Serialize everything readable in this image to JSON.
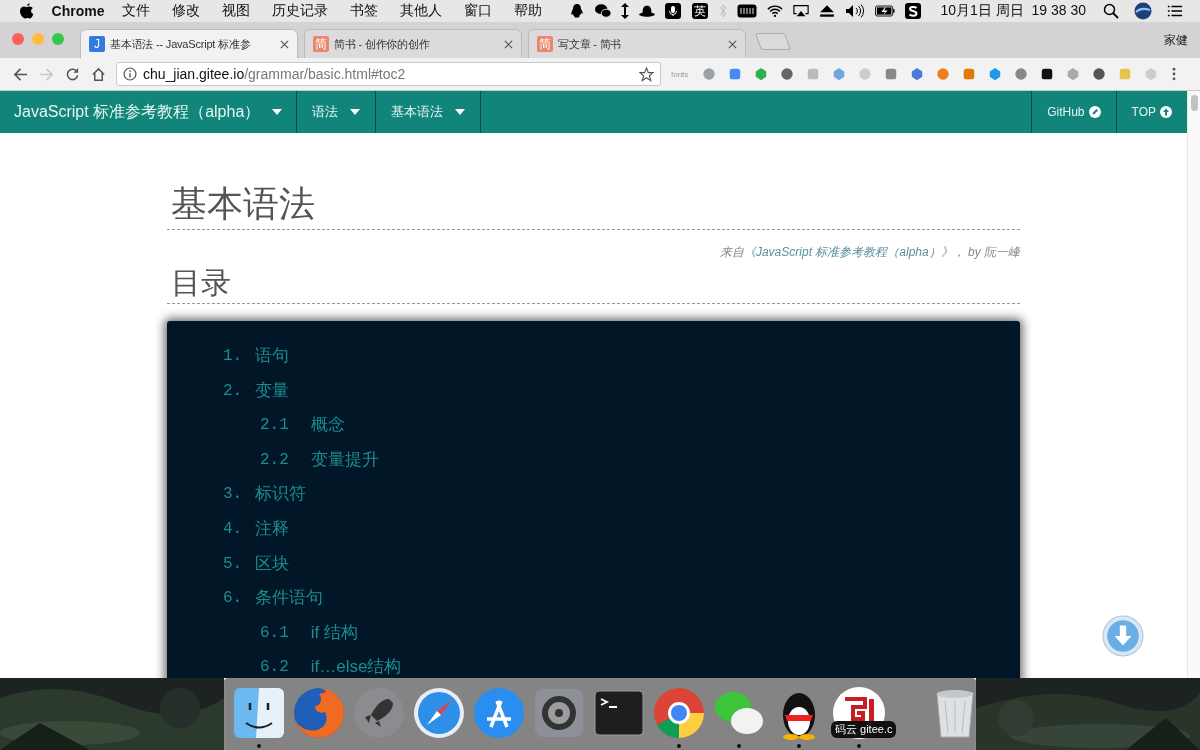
{
  "menu_bar": {
    "app": "Chrome",
    "menus": [
      "文件",
      "修改",
      "视图",
      "历史记录",
      "书签",
      "其他人",
      "窗口",
      "帮助"
    ],
    "input_method": "英",
    "clock": "10月1日 周日  19 38 30"
  },
  "browser": {
    "tabs": [
      {
        "title": "基本语法 -- JavaScript 标准参",
        "favicon": "J",
        "color": "#2f7be0",
        "selected": true
      },
      {
        "title": "简书 - 创作你的创作",
        "favicon": "简",
        "color": "#e9896b",
        "selected": false
      },
      {
        "title": "写文章 - 简书",
        "favicon": "简",
        "color": "#e9896b",
        "selected": false
      }
    ],
    "profile": "家健",
    "address": {
      "host": "chu_jian.gitee.io",
      "path": "/grammar/basic.html#toc2"
    },
    "extension_label": "fonts"
  },
  "page": {
    "navbar": {
      "brand": "JavaScript 标准参考教程（alpha）",
      "menus": [
        "语法",
        "基本语法"
      ],
      "links": [
        "GitHub",
        "TOP"
      ]
    },
    "title": "基本语法",
    "byline": {
      "prefix": "来自",
      "link": "《JavaScript 标准参考教程（alpha）》",
      "suffix": "， by 阮一峰"
    },
    "toc_title": "目录",
    "toc": [
      {
        "number": "1.",
        "label": "语句"
      },
      {
        "number": "2.",
        "label": "变量",
        "children": [
          {
            "number": "2.1",
            "label": "概念"
          },
          {
            "number": "2.2",
            "label": "变量提升"
          }
        ]
      },
      {
        "number": "3.",
        "label": "标识符"
      },
      {
        "number": "4.",
        "label": "注释"
      },
      {
        "number": "5.",
        "label": "区块"
      },
      {
        "number": "6.",
        "label": "条件语句",
        "children": [
          {
            "number": "6.1",
            "label": "if 结构"
          },
          {
            "number": "6.2",
            "label": "if…else结构"
          }
        ]
      }
    ]
  },
  "dock": {
    "apps": [
      {
        "kind": "finder",
        "running": true
      },
      {
        "kind": "firefox",
        "running": false
      },
      {
        "kind": "launchpad",
        "running": false
      },
      {
        "kind": "safari",
        "running": false
      },
      {
        "kind": "appstore",
        "running": false
      },
      {
        "kind": "settings",
        "running": false
      },
      {
        "kind": "terminal",
        "running": false
      },
      {
        "kind": "chrome",
        "running": true
      },
      {
        "kind": "wechat",
        "running": true
      },
      {
        "kind": "qq",
        "running": true
      },
      {
        "kind": "gitee",
        "running": true,
        "tooltip": "码云 gitee.c"
      }
    ],
    "trash": {
      "kind": "trash"
    }
  }
}
